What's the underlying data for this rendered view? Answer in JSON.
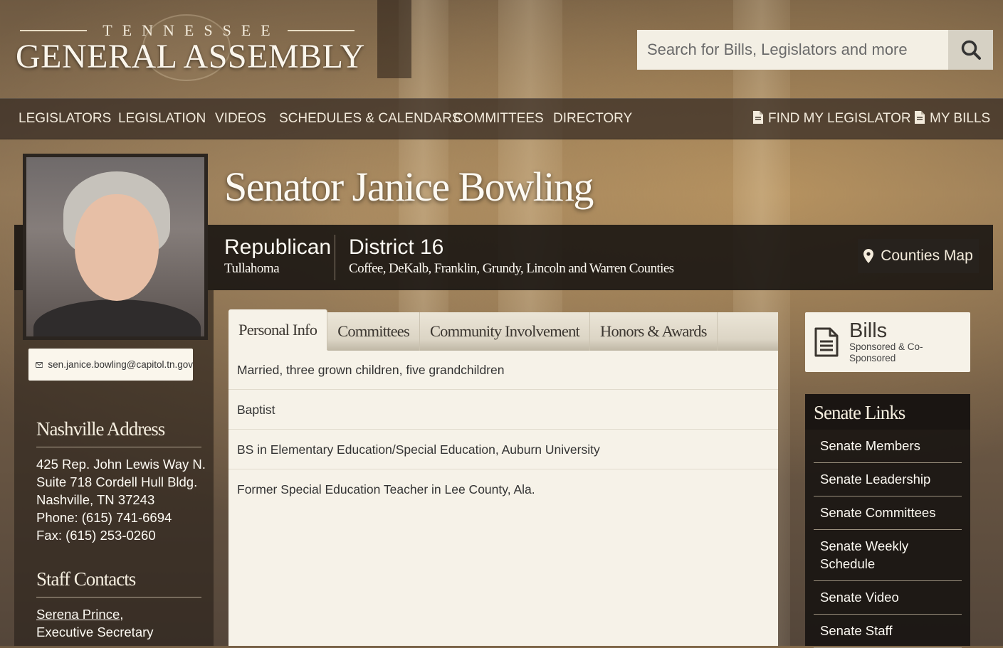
{
  "header": {
    "logo_top": "TENNESSEE",
    "logo_main": "GENERAL ASSEMBLY",
    "search_placeholder": "Search for Bills, Legislators and more"
  },
  "nav": {
    "items": [
      "LEGISLATORS",
      "LEGISLATION",
      "VIDEOS",
      "SCHEDULES & CALENDARS",
      "COMMITTEES",
      "DIRECTORY"
    ],
    "find_legislator": "FIND MY LEGISLATOR",
    "my_bills": "MY BILLS"
  },
  "profile": {
    "name": "Senator Janice Bowling",
    "party": "Republican",
    "hometown": "Tullahoma",
    "district": "District 16",
    "counties": "Coffee, DeKalb, Franklin, Grundy, Lincoln and Warren Counties",
    "counties_map_label": "Counties Map",
    "email": "sen.janice.bowling@capitol.tn.gov"
  },
  "sidebar_left": {
    "address_heading": "Nashville Address",
    "address_lines": [
      "425 Rep. John Lewis Way N.",
      "Suite 718 Cordell Hull Bldg.",
      "Nashville, TN 37243",
      "Phone: (615) 741-6694",
      "Fax: (615) 253-0260"
    ],
    "staff_heading": "Staff Contacts",
    "staff_name": "Serena Prince",
    "staff_role": "Executive Secretary"
  },
  "tabs": {
    "labels": [
      "Personal Info",
      "Committees",
      "Community Involvement",
      "Honors & Awards"
    ],
    "active": "Personal Info",
    "personal_info": [
      "Married, three grown children, five grandchildren",
      "Baptist",
      "BS in Elementary Education/Special Education, Auburn University",
      "Former Special Education Teacher in Lee County, Ala."
    ]
  },
  "bills_card": {
    "title": "Bills",
    "subtitle": "Sponsored & Co-Sponsored"
  },
  "senate_links": {
    "title": "Senate Links",
    "items": [
      "Senate Members",
      "Senate Leadership",
      "Senate Committees",
      "Senate Weekly Schedule",
      "Senate Video",
      "Senate Staff"
    ]
  },
  "colors": {
    "cream_panel": "#f6f2e8",
    "dark_band": "#161210",
    "nav_text": "#f3ebdc"
  }
}
